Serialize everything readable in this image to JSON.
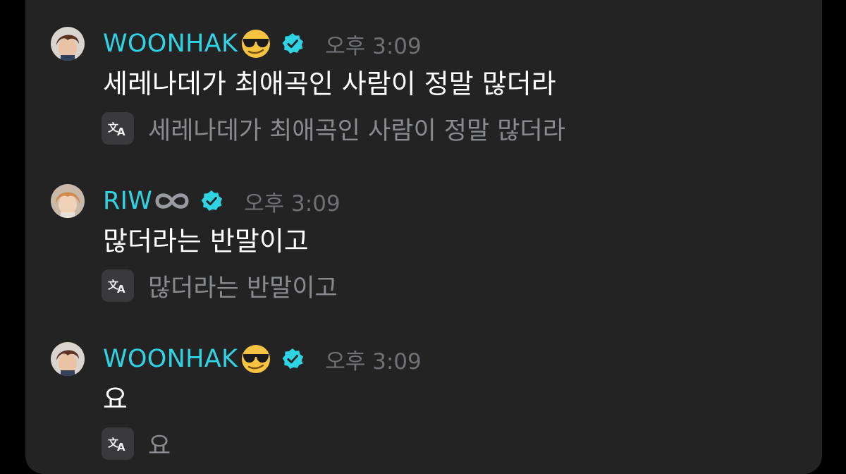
{
  "colors": {
    "background": "#232324",
    "username": "#2fd4e4",
    "timestamp": "#6f7073",
    "message_text": "#ffffff",
    "translation_text": "#8a8b8e",
    "verified_badge": "#2fd4e4"
  },
  "messages": [
    {
      "username": "WOONHAK",
      "username_emoji": "sunglasses-face-emoji",
      "verified": true,
      "timestamp": "오후 3:09",
      "text": "세레나데가 최애곡인 사람이 정말 많더라",
      "translation_icon": "translate-icon",
      "translation": "세레나데가 최애곡인 사람이 정말 많더라"
    },
    {
      "username": "RIW",
      "username_emoji": "infinity-emoji",
      "verified": true,
      "timestamp": "오후 3:09",
      "text": "많더라는 반말이고",
      "translation_icon": "translate-icon",
      "translation": "많더라는 반말이고"
    },
    {
      "username": "WOONHAK",
      "username_emoji": "sunglasses-face-emoji",
      "verified": true,
      "timestamp": "오후 3:09",
      "text": "요",
      "translation_icon": "translate-icon",
      "translation": "요"
    }
  ]
}
